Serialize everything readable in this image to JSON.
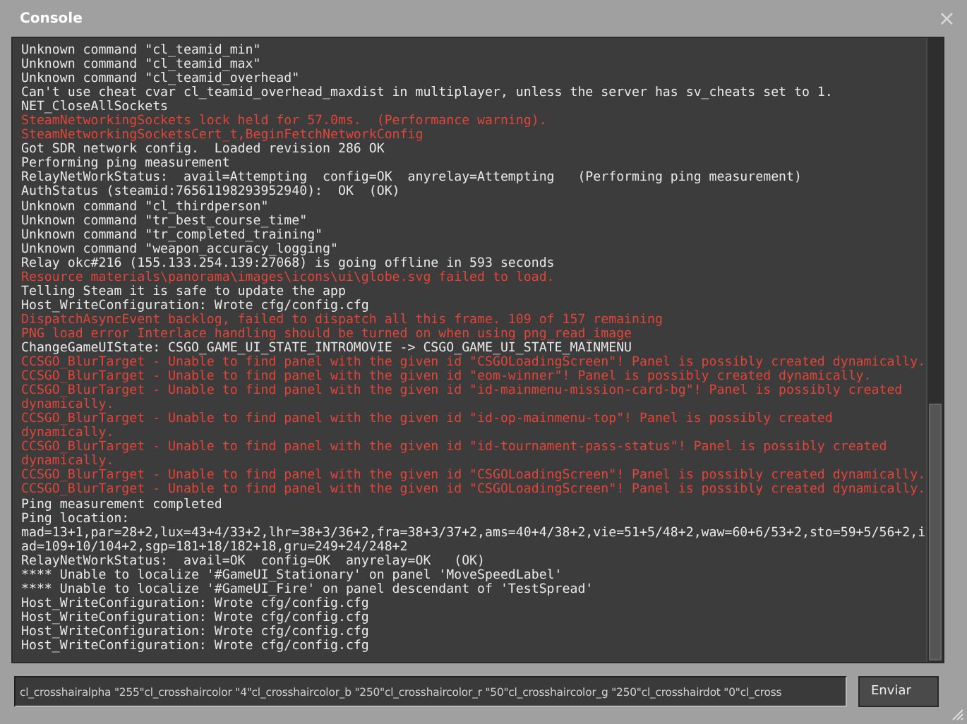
{
  "window": {
    "title": "Console",
    "close": "×"
  },
  "log": [
    {
      "kind": "info",
      "text": "Unknown command \"cl_teamid_min\""
    },
    {
      "kind": "info",
      "text": "Unknown command \"cl_teamid_max\""
    },
    {
      "kind": "info",
      "text": "Unknown command \"cl_teamid_overhead\""
    },
    {
      "kind": "info",
      "text": "Can't use cheat cvar cl_teamid_overhead_maxdist in multiplayer, unless the server has sv_cheats set to 1."
    },
    {
      "kind": "info",
      "text": "NET_CloseAllSockets"
    },
    {
      "kind": "error",
      "text": "SteamNetworkingSockets lock held for 57.0ms.  (Performance warning)."
    },
    {
      "kind": "error",
      "text": "SteamNetworkingSocketsCert_t,BeginFetchNetworkConfig"
    },
    {
      "kind": "info",
      "text": "Got SDR network config.  Loaded revision 286 OK"
    },
    {
      "kind": "info",
      "text": "Performing ping measurement"
    },
    {
      "kind": "info",
      "text": "RelayNetWorkStatus:  avail=Attempting  config=OK  anyrelay=Attempting   (Performing ping measurement)"
    },
    {
      "kind": "info",
      "text": "AuthStatus (steamid:76561198293952940):  OK  (OK)"
    },
    {
      "kind": "info",
      "text": "Unknown command \"cl_thirdperson\""
    },
    {
      "kind": "info",
      "text": "Unknown command \"tr_best_course_time\""
    },
    {
      "kind": "info",
      "text": "Unknown command \"tr_completed_training\""
    },
    {
      "kind": "info",
      "text": "Unknown command \"weapon_accuracy_logging\""
    },
    {
      "kind": "info",
      "text": "Relay okc#216 (155.133.254.139:27068) is going offline in 593 seconds"
    },
    {
      "kind": "error",
      "text": "Resource materials\\panorama\\images\\icons\\ui\\globe.svg failed to load."
    },
    {
      "kind": "info",
      "text": "Telling Steam it is safe to update the app"
    },
    {
      "kind": "info",
      "text": "Host_WriteConfiguration: Wrote cfg/config.cfg"
    },
    {
      "kind": "error",
      "text": "DispatchAsyncEvent backlog, failed to dispatch all this frame. 109 of 157 remaining"
    },
    {
      "kind": "error",
      "text": "PNG load error Interlace handling should be turned on when using png_read_image"
    },
    {
      "kind": "info",
      "text": "ChangeGameUIState: CSGO_GAME_UI_STATE_INTROMOVIE -> CSGO_GAME_UI_STATE_MAINMENU"
    },
    {
      "kind": "error",
      "text": "CCSGO_BlurTarget - Unable to find panel with the given id \"CSGOLoadingScreen\"! Panel is possibly created dynamically."
    },
    {
      "kind": "error",
      "text": "CCSGO_BlurTarget - Unable to find panel with the given id \"eom-winner\"! Panel is possibly created dynamically."
    },
    {
      "kind": "error",
      "text": "CCSGO_BlurTarget - Unable to find panel with the given id \"id-mainmenu-mission-card-bg\"! Panel is possibly created dynamically."
    },
    {
      "kind": "error",
      "text": "CCSGO_BlurTarget - Unable to find panel with the given id \"id-op-mainmenu-top\"! Panel is possibly created dynamically."
    },
    {
      "kind": "error",
      "text": "CCSGO_BlurTarget - Unable to find panel with the given id \"id-tournament-pass-status\"! Panel is possibly created dynamically."
    },
    {
      "kind": "error",
      "text": "CCSGO_BlurTarget - Unable to find panel with the given id \"CSGOLoadingScreen\"! Panel is possibly created dynamically."
    },
    {
      "kind": "error",
      "text": "CCSGO_BlurTarget - Unable to find panel with the given id \"CSGOLoadingScreen\"! Panel is possibly created dynamically."
    },
    {
      "kind": "info",
      "text": "Ping measurement completed"
    },
    {
      "kind": "info",
      "text": "Ping location:"
    },
    {
      "kind": "info",
      "text": "mad=13+1,par=28+2,lux=43+4/33+2,lhr=38+3/36+2,fra=38+3/37+2,ams=40+4/38+2,vie=51+5/48+2,waw=60+6/53+2,sto=59+5/56+2,iad=109+10/104+2,sgp=181+18/182+18,gru=249+24/248+2"
    },
    {
      "kind": "info",
      "text": "RelayNetWorkStatus:  avail=OK  config=OK  anyrelay=OK   (OK)"
    },
    {
      "kind": "info",
      "text": "**** Unable to localize '#GameUI_Stationary' on panel 'MoveSpeedLabel'"
    },
    {
      "kind": "info",
      "text": "**** Unable to localize '#GameUI_Fire' on panel descendant of 'TestSpread'"
    },
    {
      "kind": "info",
      "text": "Host_WriteConfiguration: Wrote cfg/config.cfg"
    },
    {
      "kind": "info",
      "text": "Host_WriteConfiguration: Wrote cfg/config.cfg"
    },
    {
      "kind": "info",
      "text": "Host_WriteConfiguration: Wrote cfg/config.cfg"
    },
    {
      "kind": "info",
      "text": "Host_WriteConfiguration: Wrote cfg/config.cfg"
    }
  ],
  "command_input": {
    "value": "cl_crosshairalpha \"255\"cl_crosshaircolor \"4\"cl_crosshaircolor_b \"250\"cl_crosshaircolor_r \"50\"cl_crosshaircolor_g \"250\"cl_crosshairdot \"0\"cl_cross"
  },
  "submit_button": "Enviar"
}
